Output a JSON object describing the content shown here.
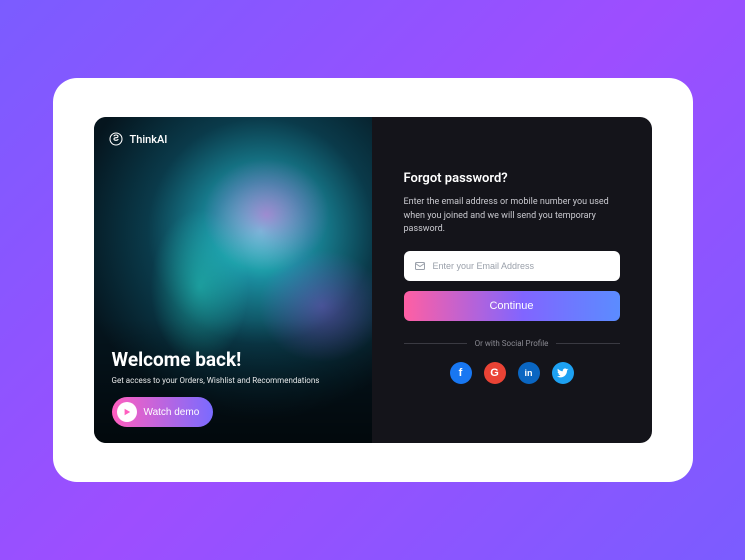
{
  "brand": {
    "name": "ThinkAI"
  },
  "left": {
    "title": "Welcome back!",
    "subtitle": "Get access to your Orders, Wishlist and Recommendations",
    "demo_label": "Watch demo"
  },
  "form": {
    "title": "Forgot password?",
    "description": "Enter the email address or mobile number you used when you joined and we will send you temporary password.",
    "email_placeholder": "Enter your Email Address",
    "continue_label": "Continue",
    "divider_label": "Or with Social Profile"
  },
  "socials": {
    "facebook": "f",
    "google": "G",
    "linkedin": "in",
    "twitter": "twitter"
  },
  "colors": {
    "gradient_pink": "#ff5fa3",
    "gradient_purple": "#8165ff",
    "gradient_blue": "#5b8cff"
  }
}
